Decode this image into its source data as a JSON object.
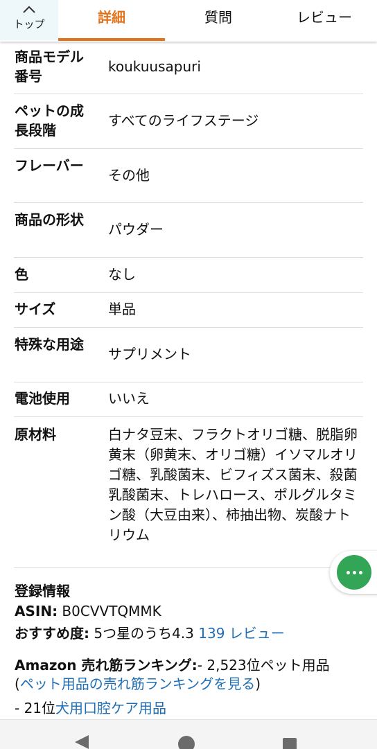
{
  "tabs": {
    "top_label": "トップ",
    "details": "詳細",
    "questions": "質問",
    "reviews": "レビュー"
  },
  "specs": [
    {
      "key": "商品モデル番号",
      "value": "koukuusapuri"
    },
    {
      "key": "ペットの成長段階",
      "value": "すべてのライフステージ"
    },
    {
      "key": "フレーバー",
      "value": "その他"
    },
    {
      "key": "商品の形状",
      "value": "パウダー"
    },
    {
      "key": "色",
      "value": "なし"
    },
    {
      "key": "サイズ",
      "value": "単品"
    },
    {
      "key": "特殊な用途",
      "value": "サプリメント"
    },
    {
      "key": "電池使用",
      "value": "いいえ"
    },
    {
      "key": "原材料",
      "value": "白ナタ豆末、フラクトオリゴ糖、脱脂卵黄末（卵黄末、オリゴ糖）イソマルオリゴ糖、乳酸菌末、ビフィズス菌末、殺菌乳酸菌末、トレハロース、ポルグルタミン酸（大豆由来）、柿抽出物、炭酸ナトリウム"
    }
  ],
  "registration": {
    "title": "登録情報",
    "asin_label": "ASIN:",
    "asin_value": "B0CVVTQMMK",
    "recommend_label": "おすすめ度:",
    "recommend_value": "5つ星のうち4.3",
    "review_link": "139 レビュー",
    "ranking_label": "Amazon 売れ筋ランキング:",
    "ranking_value": "- 2,523位ペット用品",
    "ranking_open": "(",
    "ranking_link": "ペット用品の売れ筋ランキングを見る",
    "ranking_close": ")",
    "subrank_prefix": "- 21位",
    "subrank_link": "犬用口腔ケア用品"
  },
  "colors": {
    "accent": "#e3731b",
    "link": "#1f6eb3",
    "fab": "#33a556"
  },
  "icons": {
    "top": "chevron-up-icon",
    "fab": "more-dots-icon",
    "nav": [
      "back-icon",
      "home-icon",
      "recents-icon"
    ]
  }
}
